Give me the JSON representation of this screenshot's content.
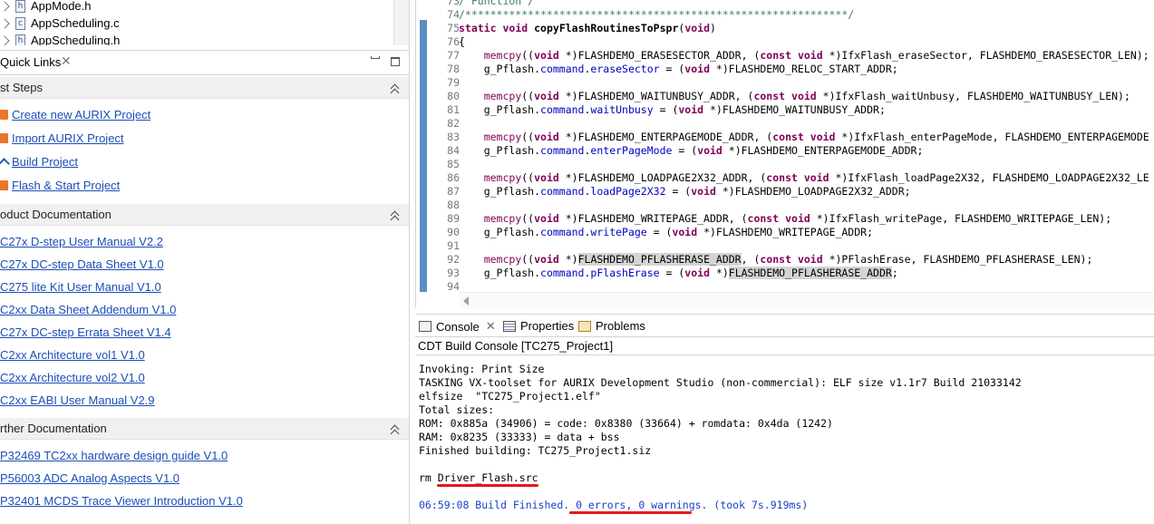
{
  "project_explorer": {
    "files": [
      {
        "name": "AppMode.h",
        "icon": "header-file-icon",
        "glyph": "h"
      },
      {
        "name": "AppScheduling.c",
        "icon": "c-file-icon",
        "glyph": "c"
      },
      {
        "name": "AppScheduling.h",
        "icon": "header-file-icon",
        "glyph": "h"
      }
    ]
  },
  "quick_links": {
    "title": "Quick Links",
    "close": "✕",
    "sections": [
      {
        "title": "st Steps",
        "links": [
          {
            "label": "Create new AURIX Project",
            "icon": "new-project-icon"
          },
          {
            "label": "Import AURIX Project",
            "icon": "import-icon"
          },
          {
            "label": "Build Project",
            "icon": "hammer-icon"
          },
          {
            "label": "Flash & Start Project",
            "icon": "flash-icon"
          }
        ]
      },
      {
        "title": "oduct Documentation",
        "links": [
          {
            "label": "C27x D-step User Manual V2.2"
          },
          {
            "label": "C27x DC-step Data Sheet V1.0"
          },
          {
            "label": "C275 lite Kit User Manual V1.0"
          },
          {
            "label": "C2xx Data Sheet Addendum V1.0"
          },
          {
            "label": "C27x DC-step Errata Sheet V1.4"
          },
          {
            "label": "C2xx Architecture vol1 V1.0"
          },
          {
            "label": "C2xx Architecture vol2 V1.0"
          },
          {
            "label": "C2xx EABI User Manual V2.9"
          }
        ]
      },
      {
        "title": "rther Documentation",
        "links": [
          {
            "label": "P32469 TC2xx hardware design guide V1.0"
          },
          {
            "label": "P56003 ADC Analog Aspects V1.0"
          },
          {
            "label": "P32401 MCDS Trace Viewer Introduction V1.0"
          }
        ]
      }
    ]
  },
  "editor": {
    "lines": [
      {
        "n": "73",
        "t": "/ Function /"
      },
      {
        "n": "74",
        "t": "/*************************************************************/"
      },
      {
        "n": "75",
        "t": "static void copyFlashRoutinesToPspr(void)"
      },
      {
        "n": "76",
        "t": "{"
      },
      {
        "n": "77",
        "t": "    memcpy((void *)FLASHDEMO_ERASESECTOR_ADDR, (const void *)IfxFlash_eraseSector, FLASHDEMO_ERASESECTOR_LEN);"
      },
      {
        "n": "78",
        "t": "    g_Pflash.command.eraseSector = (void *)FLASHDEMO_RELOC_START_ADDR;"
      },
      {
        "n": "79",
        "t": ""
      },
      {
        "n": "80",
        "t": "    memcpy((void *)FLASHDEMO_WAITUNBUSY_ADDR, (const void *)IfxFlash_waitUnbusy, FLASHDEMO_WAITUNBUSY_LEN);"
      },
      {
        "n": "81",
        "t": "    g_Pflash.command.waitUnbusy = (void *)FLASHDEMO_WAITUNBUSY_ADDR;"
      },
      {
        "n": "82",
        "t": ""
      },
      {
        "n": "83",
        "t": "    memcpy((void *)FLASHDEMO_ENTERPAGEMODE_ADDR, (const void *)IfxFlash_enterPageMode, FLASHDEMO_ENTERPAGEMODE"
      },
      {
        "n": "84",
        "t": "    g_Pflash.command.enterPageMode = (void *)FLASHDEMO_ENTERPAGEMODE_ADDR;"
      },
      {
        "n": "85",
        "t": ""
      },
      {
        "n": "86",
        "t": "    memcpy((void *)FLASHDEMO_LOADPAGE2X32_ADDR, (const void *)IfxFlash_loadPage2X32, FLASHDEMO_LOADPAGE2X32_LE"
      },
      {
        "n": "87",
        "t": "    g_Pflash.command.loadPage2X32 = (void *)FLASHDEMO_LOADPAGE2X32_ADDR;"
      },
      {
        "n": "88",
        "t": ""
      },
      {
        "n": "89",
        "t": "    memcpy((void *)FLASHDEMO_WRITEPAGE_ADDR, (const void *)IfxFlash_writePage, FLASHDEMO_WRITEPAGE_LEN);"
      },
      {
        "n": "90",
        "t": "    g_Pflash.command.writePage = (void *)FLASHDEMO_WRITEPAGE_ADDR;"
      },
      {
        "n": "91",
        "t": ""
      },
      {
        "n": "92",
        "t": "    memcpy((void *)FLASHDEMO_PFLASHERASE_ADDR, (const void *)PFlashErase, FLASHDEMO_PFLASHERASE_LEN);"
      },
      {
        "n": "93",
        "t": "    g_Pflash.command.pFlashErase = (void *)FLASHDEMO_PFLASHERASE_ADDR;"
      },
      {
        "n": "94",
        "t": ""
      }
    ]
  },
  "console": {
    "tabs": [
      {
        "label": "Console",
        "icon": "console-icon",
        "close": "✕"
      },
      {
        "label": "Properties",
        "icon": "properties-icon"
      },
      {
        "label": "Problems",
        "icon": "problems-icon"
      }
    ],
    "subtitle": "CDT Build Console [TC275_Project1]",
    "output": [
      "Invoking: Print Size",
      "TASKING VX-toolset for AURIX Development Studio (non-commercial): ELF size v1.1r7 Build 21033142",
      "elfsize  \"TC275_Project1.elf\"",
      "Total sizes:",
      "ROM: 0x885a (34906) = code: 0x8380 (33664) + romdata: 0x4da (1242)",
      "RAM: 0x8235 (33333) = data + bss",
      "Finished building: TC275_Project1.siz",
      "",
      "rm Driver_Flash.src",
      "",
      "06:59:08 Build Finished. 0 errors, 0 warnings. (took 7s.919ms)"
    ],
    "annotation_color": "#e8141c"
  }
}
